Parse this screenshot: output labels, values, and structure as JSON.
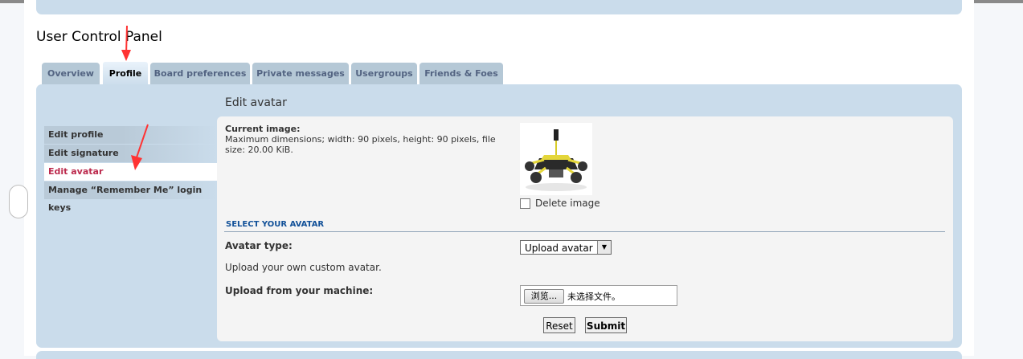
{
  "page": {
    "title": "User Control Panel"
  },
  "tabs": [
    "Overview",
    "Profile",
    "Board preferences",
    "Private messages",
    "Usergroups",
    "Friends & Foes"
  ],
  "sidebar": [
    "Edit profile",
    "Edit signature",
    "Edit avatar",
    "Manage “Remember Me” login keys"
  ],
  "section": {
    "title": "Edit avatar",
    "current_label": "Current image:",
    "current_desc": "Maximum dimensions; width: 90 pixels, height: 90 pixels, file size: 20.00 KiB.",
    "delete_label": "Delete image",
    "select_header": "SELECT YOUR AVATAR",
    "type_label": "Avatar type:",
    "type_value": "Upload avatar",
    "upload_desc": "Upload your own custom avatar.",
    "upload_label": "Upload from your machine:",
    "browse_label": "浏览...",
    "no_file_label": "未选择文件。",
    "reset_label": "Reset",
    "submit_label": "Submit"
  },
  "colors": {
    "panel": "#cadceb",
    "tab": "#b5c8d6",
    "active_text": "#bc2a4d",
    "annotation": "#ff3333"
  }
}
